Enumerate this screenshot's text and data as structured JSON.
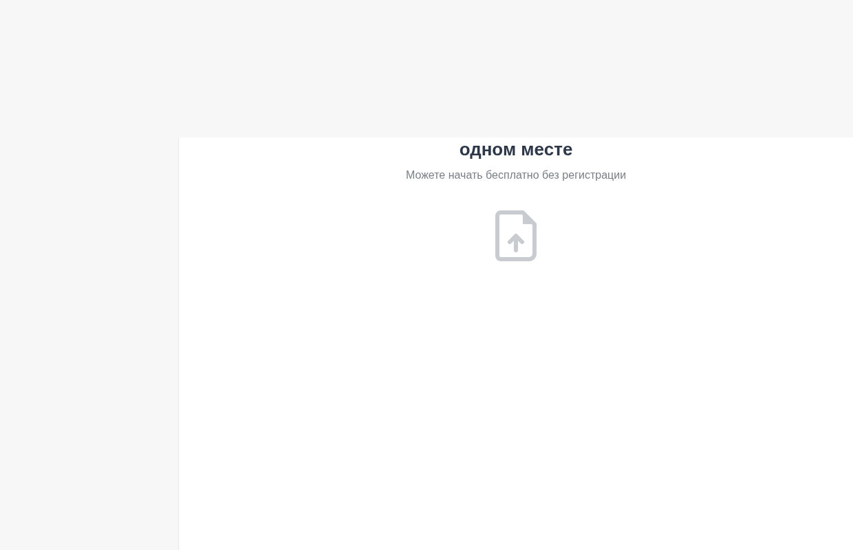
{
  "main": {
    "heading": "одном месте",
    "subtitle": "Можете начать бесплатно без регистрации"
  }
}
